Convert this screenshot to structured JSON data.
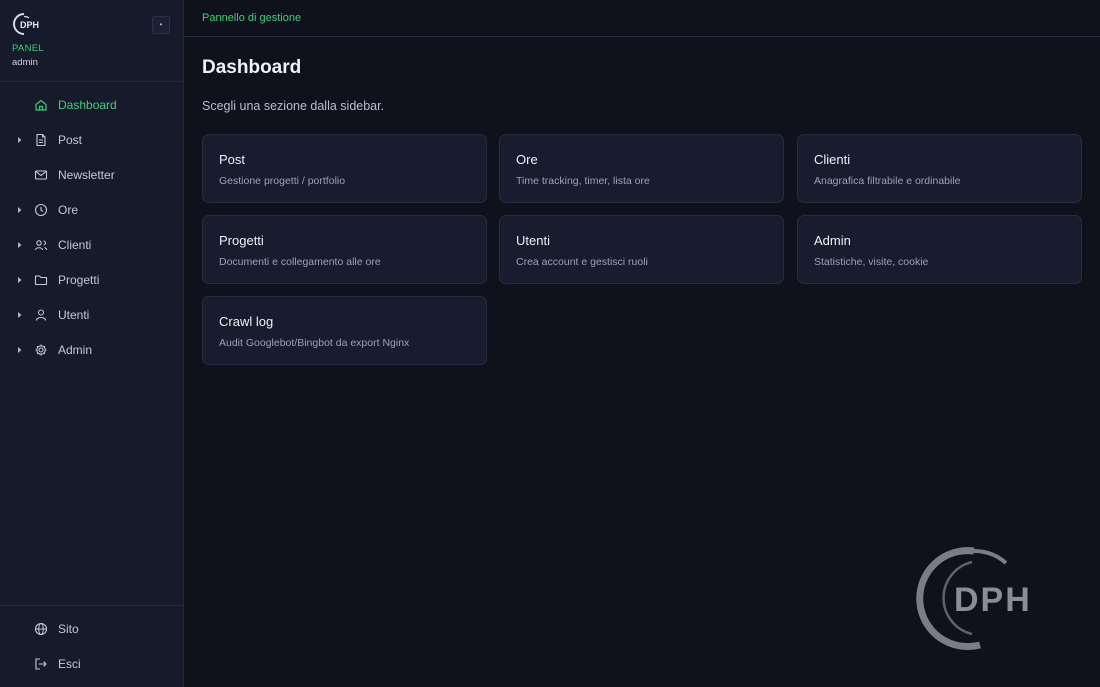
{
  "brand": {
    "logo_text": "DPH",
    "panel_label": "PANEL",
    "user": "admin",
    "collapse_glyph": "•"
  },
  "sidebar": {
    "items": [
      {
        "label": "Dashboard",
        "icon": "home-icon",
        "active": true,
        "expandable": false
      },
      {
        "label": "Post",
        "icon": "document-icon",
        "active": false,
        "expandable": true
      },
      {
        "label": "Newsletter",
        "icon": "mail-icon",
        "active": false,
        "expandable": false
      },
      {
        "label": "Ore",
        "icon": "clock-icon",
        "active": false,
        "expandable": true
      },
      {
        "label": "Clienti",
        "icon": "users-icon",
        "active": false,
        "expandable": true
      },
      {
        "label": "Progetti",
        "icon": "folder-icon",
        "active": false,
        "expandable": true
      },
      {
        "label": "Utenti",
        "icon": "user-icon",
        "active": false,
        "expandable": true
      },
      {
        "label": "Admin",
        "icon": "gear-icon",
        "active": false,
        "expandable": true
      }
    ],
    "footer": [
      {
        "label": "Sito",
        "icon": "globe-icon"
      },
      {
        "label": "Esci",
        "icon": "logout-icon"
      }
    ]
  },
  "topbar": {
    "breadcrumb": "Pannello di gestione"
  },
  "main": {
    "title": "Dashboard",
    "subtitle": "Scegli una sezione dalla sidebar.",
    "cards": [
      {
        "title": "Post",
        "desc": "Gestione progetti / portfolio"
      },
      {
        "title": "Ore",
        "desc": "Time tracking, timer, lista ore"
      },
      {
        "title": "Clienti",
        "desc": "Anagrafica filtrabile e ordinabile"
      },
      {
        "title": "Progetti",
        "desc": "Documenti e collegamento alle ore"
      },
      {
        "title": "Utenti",
        "desc": "Crea account e gestisci ruoli"
      },
      {
        "title": "Admin",
        "desc": "Statistiche, visite, cookie"
      },
      {
        "title": "Crawl log",
        "desc": "Audit Googlebot/Bingbot da export Nginx"
      }
    ]
  },
  "watermark": {
    "text": "DPH"
  },
  "colors": {
    "accent": "#3fcf77",
    "background": "#0f111c",
    "sidebar": "#161a2b",
    "card": "#181c2e"
  }
}
